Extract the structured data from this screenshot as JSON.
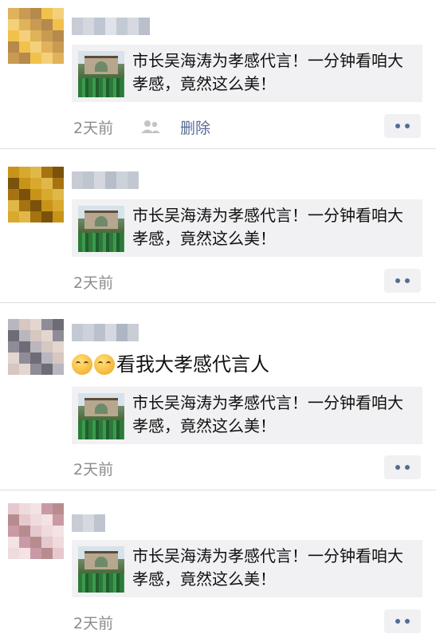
{
  "posts": [
    {
      "message": "",
      "link_card": {
        "title": "市长吴海涛为孝感代言！一分钟看咱大孝感，竟然这么美！"
      },
      "time": "2天前",
      "delete_label": "删除",
      "avatar_colors": [
        "#e0b25a",
        "#f1c24b",
        "#c99a52",
        "#f4d07a",
        "#b58a4c"
      ],
      "name_colors": [
        "#c7ccd6",
        "#d3d7de",
        "#bfc6d1",
        "#dfe2e8",
        "#c4cad4",
        "#d6dae0",
        "#b9c0cc"
      ]
    },
    {
      "message": "",
      "link_card": {
        "title": "市长吴海涛为孝感代言！一分钟看咱大孝感，竟然这么美！"
      },
      "time": "2天前",
      "delete_label": "",
      "avatar_colors": [
        "#c89418",
        "#a57310",
        "#d8a92c",
        "#7a520c",
        "#e0b849"
      ],
      "name_colors": [
        "#c6cbd4",
        "#bfc5cf",
        "#d4d8de",
        "#b7bec9",
        "#cdd2da",
        "#c2c8d2"
      ]
    },
    {
      "message": "看我大孝感代言人",
      "link_card": {
        "title": "市长吴海涛为孝感代言！一分钟看咱大孝感，竟然这么美！"
      },
      "time": "2天前",
      "delete_label": "",
      "avatar_colors": [
        "#b9b6bf",
        "#8f8c97",
        "#d6c7c1",
        "#6f6c78",
        "#e2d6cf"
      ],
      "name_colors": [
        "#c3c9d2",
        "#cdd2da",
        "#bac1cc",
        "#d5d9df",
        "#aeb6c3",
        "#c8cdd6"
      ]
    },
    {
      "message": "",
      "link_card": {
        "title": "市长吴海涛为孝感代言！一分钟看咱大孝感，竟然这么美！"
      },
      "time": "2天前",
      "delete_label": "",
      "avatar_colors": [
        "#e5c9cf",
        "#c99aa5",
        "#efdadd",
        "#b88c8e",
        "#f3e3e2"
      ],
      "name_colors": [
        "#c7ccd5",
        "#d6dae0",
        "#bec5cf"
      ]
    }
  ],
  "colors": {
    "link": "#576b95",
    "meta": "#8c8c8c",
    "card_bg": "#f1f1f3"
  }
}
